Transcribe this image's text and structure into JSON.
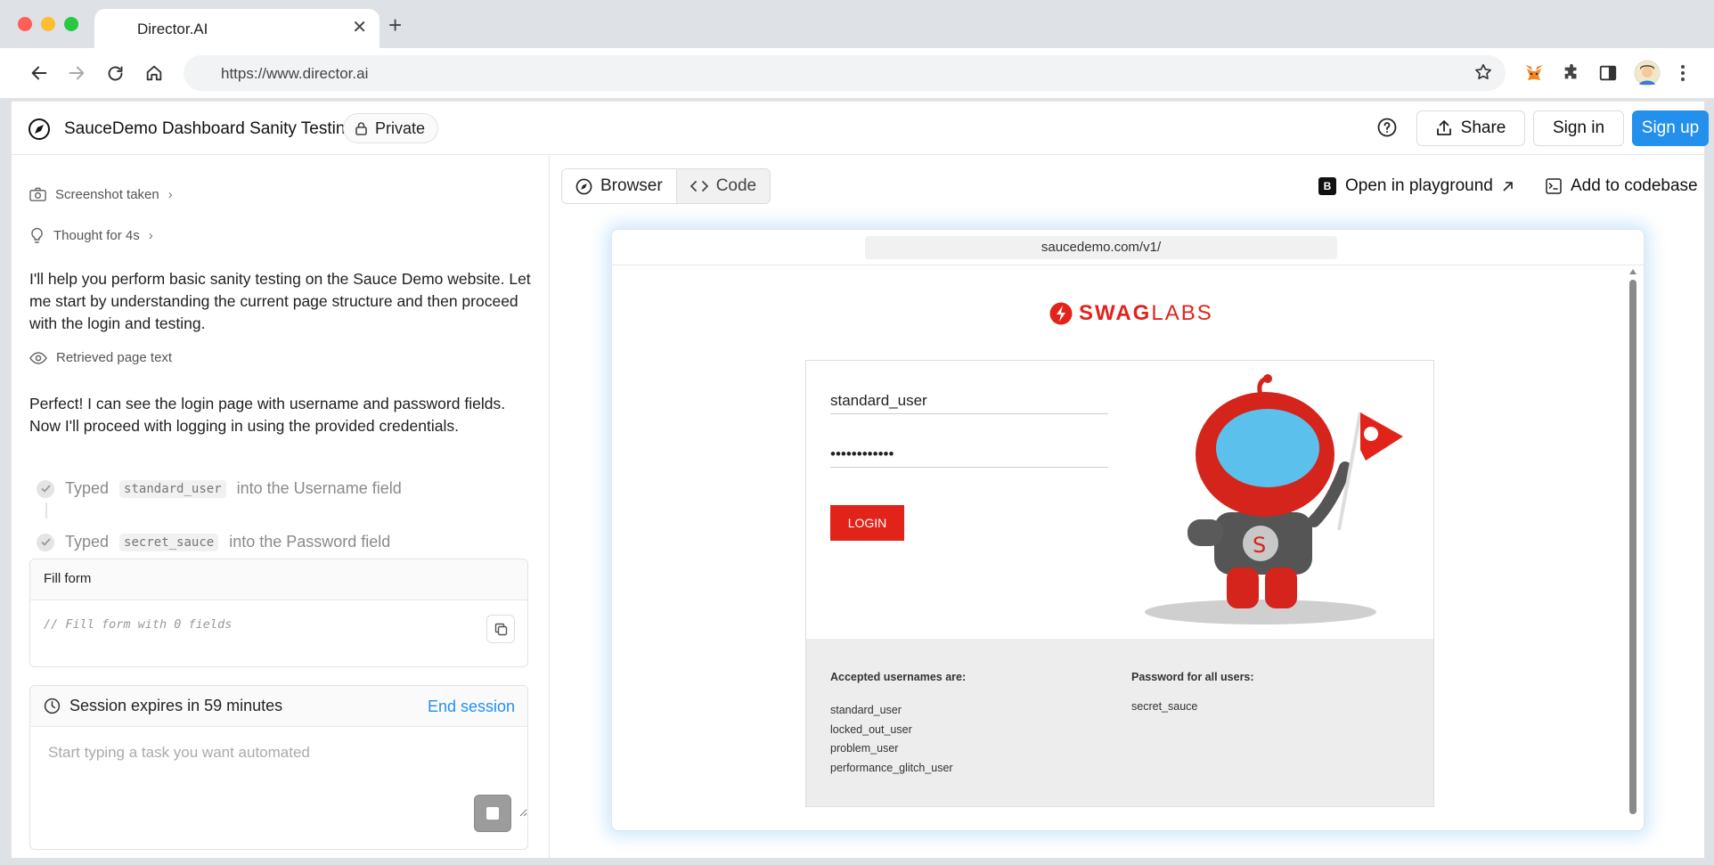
{
  "browser": {
    "tab_title": "Director.AI",
    "url": "https://www.director.ai"
  },
  "header": {
    "title": "SauceDemo Dashboard Sanity Testing",
    "privacy_label": "Private",
    "share_label": "Share",
    "signin_label": "Sign in",
    "signup_label": "Sign up"
  },
  "chat": {
    "screenshot_step": "Screenshot taken",
    "thought_step": "Thought for 4s",
    "message1": "I'll help you perform basic sanity testing on the Sauce Demo website. Let me start by understanding the current page structure and then proceed with the login and testing.",
    "retrieved_step": "Retrieved page text",
    "message2": "Perfect! I can see the login page with username and password fields. Now I'll proceed with logging in using the provided credentials.",
    "typed_actions": [
      {
        "prefix": "Typed",
        "value": "standard_user",
        "suffix": "into the Username field"
      },
      {
        "prefix": "Typed",
        "value": "secret_sauce",
        "suffix": "into the Password field"
      }
    ],
    "fill_form": {
      "title": "Fill form",
      "code": "// Fill form with 0 fields"
    },
    "session": {
      "text": "Session expires in 59 minutes",
      "end_label": "End session",
      "placeholder": "Start typing a task you want automated"
    }
  },
  "panel": {
    "browser_tab": "Browser",
    "code_tab": "Code",
    "playground_label": "Open in playground",
    "playground_badge": "B",
    "codebase_label": "Add to codebase"
  },
  "site": {
    "url": "saucedemo.com/v1/",
    "logo_bold": "SWAG",
    "logo_light": "LABS",
    "username_value": "standard_user",
    "password_value": "••••••••••••",
    "login_label": "LOGIN",
    "usernames_title": "Accepted usernames are:",
    "usernames": [
      "standard_user",
      "locked_out_user",
      "problem_user",
      "performance_glitch_user"
    ],
    "password_title": "Password for all users:",
    "password_hint": "secret_sauce"
  },
  "colors": {
    "accent_blue": "#2390ec",
    "swag_red": "#e2231a"
  }
}
